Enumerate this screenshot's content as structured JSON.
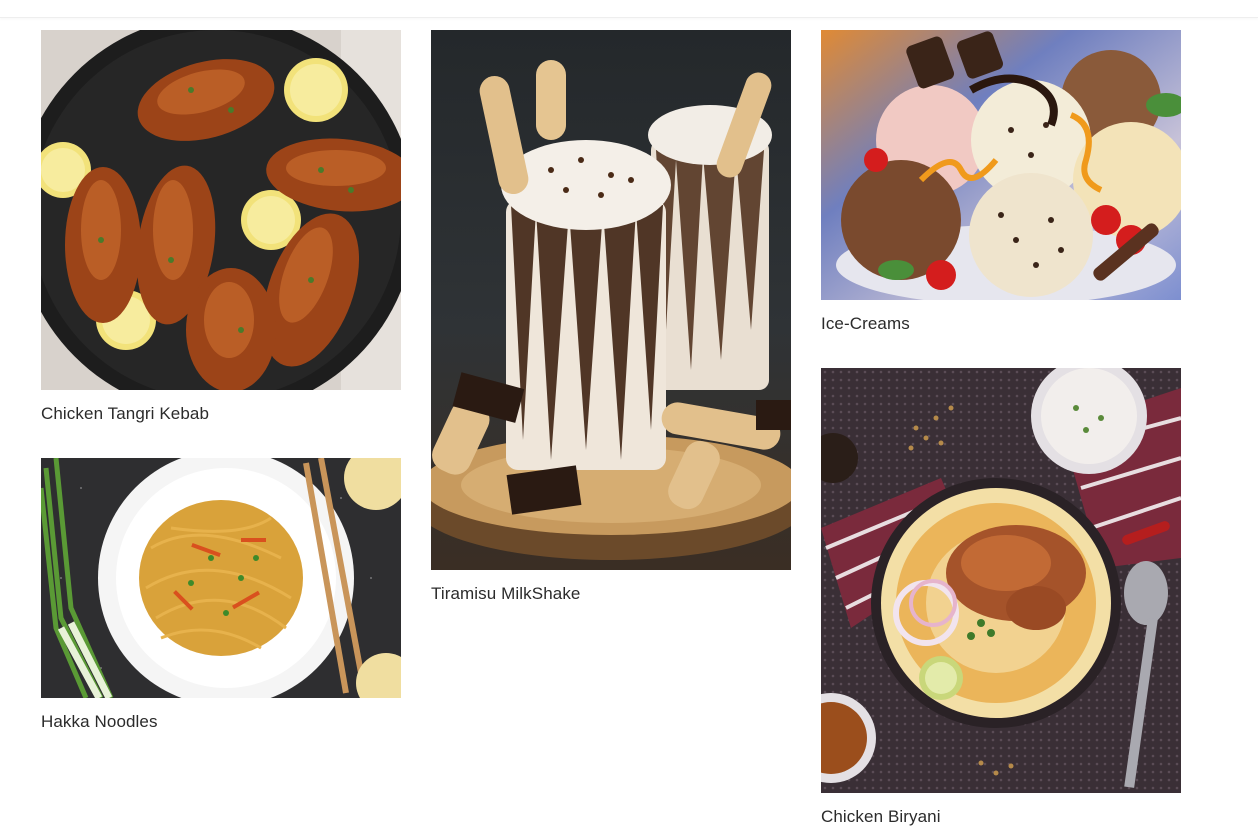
{
  "gallery": {
    "items": [
      {
        "title": "Chicken Tangri Kebab",
        "image": "chicken-tangri-kebab-photo"
      },
      {
        "title": "Tiramisu MilkShake",
        "image": "tiramisu-milkshake-photo"
      },
      {
        "title": "Ice-Creams",
        "image": "ice-creams-photo"
      },
      {
        "title": "Hakka Noodles",
        "image": "hakka-noodles-photo"
      },
      {
        "title": "Chicken Biryani",
        "image": "chicken-biryani-photo"
      }
    ]
  }
}
